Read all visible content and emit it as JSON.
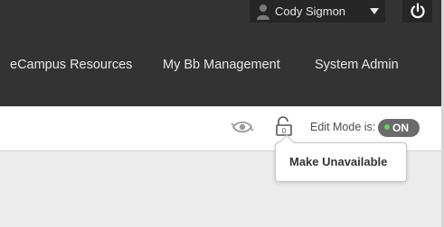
{
  "header": {
    "user_name": "Cody Sigmon",
    "avatar_icon": "user-icon",
    "dropdown_icon": "caret-down-icon",
    "logout_icon": "power-icon"
  },
  "nav": {
    "items": [
      {
        "label": "eCampus Resources"
      },
      {
        "label": "My Bb Management"
      },
      {
        "label": "System Admin"
      }
    ]
  },
  "toolbar": {
    "preview_icon": "eye-refresh-icon",
    "lock_icon": "unlock-icon",
    "lock_badge": "0",
    "edit_mode_label": "Edit Mode is:",
    "edit_mode_state": "ON"
  },
  "popover": {
    "action_label": "Make Unavailable"
  },
  "colors": {
    "header_bg": "#333333",
    "user_menu_bg": "#262626",
    "toggle_bg": "#6b6b6b",
    "toggle_indicator": "#5fd35f",
    "content_bg": "#ececec"
  }
}
